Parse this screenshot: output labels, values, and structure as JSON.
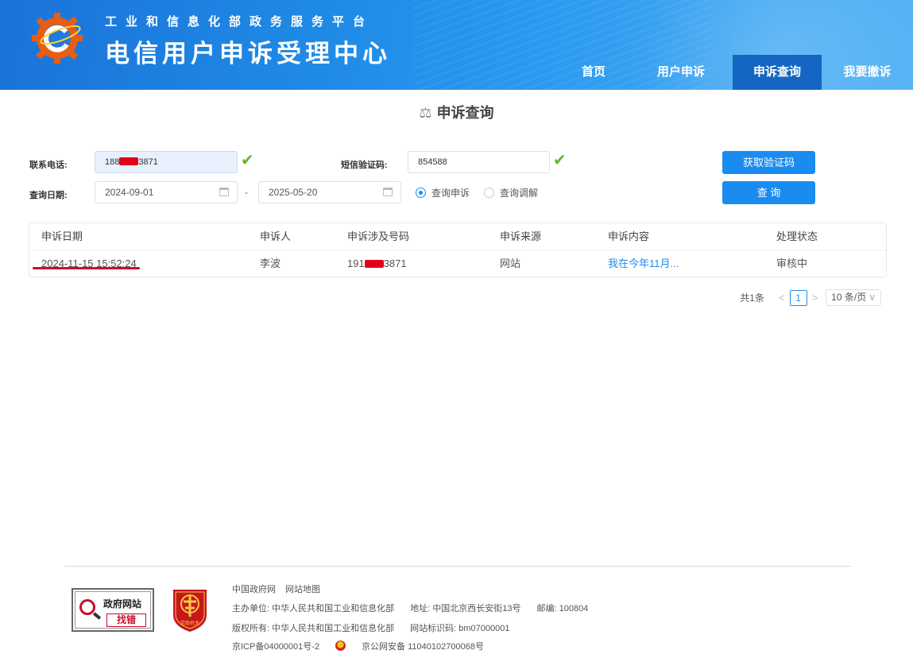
{
  "header": {
    "sub_title": "工业和信息化部政务服务平台",
    "main_title": "电信用户申诉受理中心",
    "nav": [
      "首页",
      "用户申诉",
      "申诉查询",
      "我要撤诉"
    ],
    "active_nav": "申诉查询"
  },
  "page_title": "申诉查询",
  "form": {
    "phone_label": "联系电话:",
    "phone_prefix": "188",
    "phone_suffix": "3871",
    "sms_label": "短信验证码:",
    "sms_value": "854588",
    "get_code_button": "获取验证码",
    "date_label": "查询日期:",
    "date_start": "2024-09-01",
    "date_separator": "-",
    "date_end": "2025-05-20",
    "radio_complaint": "查询申诉",
    "radio_mediation": "查询调解",
    "radio_selected": "查询申诉",
    "query_button": "查 询"
  },
  "table": {
    "headers": [
      "申诉日期",
      "申诉人",
      "申诉涉及号码",
      "申诉来源",
      "申诉内容",
      "处理状态"
    ],
    "rows": [
      {
        "date": "2024-11-15 15:52:24",
        "complainant": "李波",
        "number_prefix": "191",
        "number_suffix": "3871",
        "source": "网站",
        "content": "我在今年11月...",
        "status": "审核中"
      }
    ]
  },
  "pagination": {
    "total": "共1条",
    "current_page": "1",
    "page_size": "10 条/页"
  },
  "footer": {
    "badge_gov_line1": "政府网站",
    "badge_gov_line2": "找错",
    "badge_party": "党政机关",
    "links": [
      "中国政府网",
      "网站地图"
    ],
    "host": "主办单位: 中华人民共和国工业和信息化部",
    "address": "地址: 中国北京西长安街13号",
    "postcode": "邮编: 100804",
    "copyright": "版权所有: 中华人民共和国工业和信息化部",
    "site_id": "网站标识码: bm07000001",
    "icp": "京ICP备04000001号-2",
    "police": "京公网安备 11040102700068号"
  },
  "colors": {
    "header_blue": "#1f8ae6",
    "active_nav": "#1566c2",
    "button_blue": "#1a8cf0",
    "check_green": "#6ab42b",
    "redaction_red": "#e3001b"
  }
}
